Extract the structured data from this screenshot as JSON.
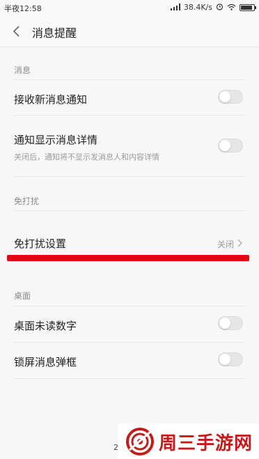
{
  "status_bar": {
    "time": "半夜12:58",
    "net_speed": "38.4K/s"
  },
  "header": {
    "title": "消息提醒"
  },
  "sections": {
    "messages": {
      "title": "消息",
      "receive_label": "接收新消息通知",
      "receive_on": false,
      "detail_label": "通知显示消息详情",
      "detail_desc": "关闭后，通知将不显示发消息人和内容详情",
      "detail_on": false
    },
    "dnd": {
      "title": "免打扰",
      "settings_label": "免打扰设置",
      "settings_value": "关闭"
    },
    "desktop": {
      "title": "桌面",
      "unread_label": "桌面未读数字",
      "unread_on": false,
      "lock_label": "锁屏消息弹框",
      "lock_on": false
    }
  },
  "watermark": {
    "text": "周三手游网",
    "color": "#c31a1a"
  },
  "highlight_color": "#e60012",
  "page_fragment": "2"
}
